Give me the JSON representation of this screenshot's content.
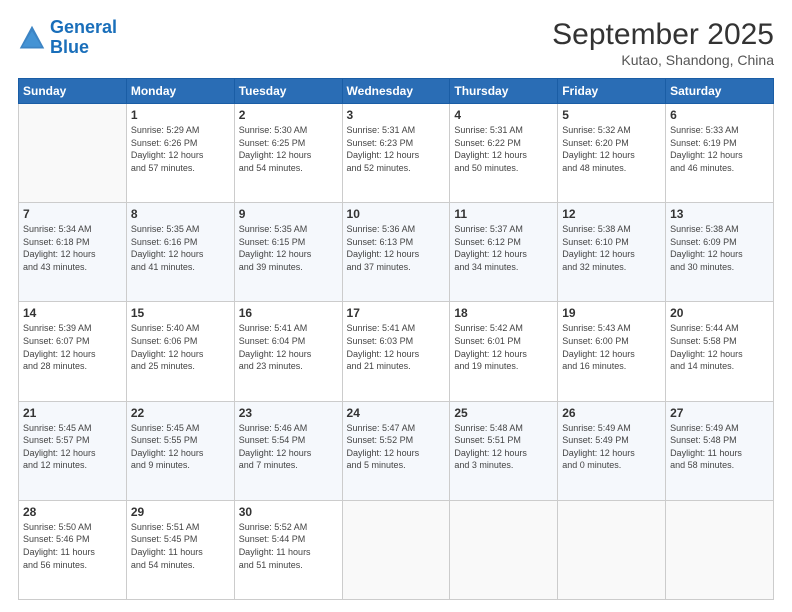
{
  "header": {
    "logo_line1": "General",
    "logo_line2": "Blue",
    "month": "September 2025",
    "location": "Kutao, Shandong, China"
  },
  "weekdays": [
    "Sunday",
    "Monday",
    "Tuesday",
    "Wednesday",
    "Thursday",
    "Friday",
    "Saturday"
  ],
  "weeks": [
    [
      {
        "day": "",
        "content": ""
      },
      {
        "day": "1",
        "content": "Sunrise: 5:29 AM\nSunset: 6:26 PM\nDaylight: 12 hours\nand 57 minutes."
      },
      {
        "day": "2",
        "content": "Sunrise: 5:30 AM\nSunset: 6:25 PM\nDaylight: 12 hours\nand 54 minutes."
      },
      {
        "day": "3",
        "content": "Sunrise: 5:31 AM\nSunset: 6:23 PM\nDaylight: 12 hours\nand 52 minutes."
      },
      {
        "day": "4",
        "content": "Sunrise: 5:31 AM\nSunset: 6:22 PM\nDaylight: 12 hours\nand 50 minutes."
      },
      {
        "day": "5",
        "content": "Sunrise: 5:32 AM\nSunset: 6:20 PM\nDaylight: 12 hours\nand 48 minutes."
      },
      {
        "day": "6",
        "content": "Sunrise: 5:33 AM\nSunset: 6:19 PM\nDaylight: 12 hours\nand 46 minutes."
      }
    ],
    [
      {
        "day": "7",
        "content": "Sunrise: 5:34 AM\nSunset: 6:18 PM\nDaylight: 12 hours\nand 43 minutes."
      },
      {
        "day": "8",
        "content": "Sunrise: 5:35 AM\nSunset: 6:16 PM\nDaylight: 12 hours\nand 41 minutes."
      },
      {
        "day": "9",
        "content": "Sunrise: 5:35 AM\nSunset: 6:15 PM\nDaylight: 12 hours\nand 39 minutes."
      },
      {
        "day": "10",
        "content": "Sunrise: 5:36 AM\nSunset: 6:13 PM\nDaylight: 12 hours\nand 37 minutes."
      },
      {
        "day": "11",
        "content": "Sunrise: 5:37 AM\nSunset: 6:12 PM\nDaylight: 12 hours\nand 34 minutes."
      },
      {
        "day": "12",
        "content": "Sunrise: 5:38 AM\nSunset: 6:10 PM\nDaylight: 12 hours\nand 32 minutes."
      },
      {
        "day": "13",
        "content": "Sunrise: 5:38 AM\nSunset: 6:09 PM\nDaylight: 12 hours\nand 30 minutes."
      }
    ],
    [
      {
        "day": "14",
        "content": "Sunrise: 5:39 AM\nSunset: 6:07 PM\nDaylight: 12 hours\nand 28 minutes."
      },
      {
        "day": "15",
        "content": "Sunrise: 5:40 AM\nSunset: 6:06 PM\nDaylight: 12 hours\nand 25 minutes."
      },
      {
        "day": "16",
        "content": "Sunrise: 5:41 AM\nSunset: 6:04 PM\nDaylight: 12 hours\nand 23 minutes."
      },
      {
        "day": "17",
        "content": "Sunrise: 5:41 AM\nSunset: 6:03 PM\nDaylight: 12 hours\nand 21 minutes."
      },
      {
        "day": "18",
        "content": "Sunrise: 5:42 AM\nSunset: 6:01 PM\nDaylight: 12 hours\nand 19 minutes."
      },
      {
        "day": "19",
        "content": "Sunrise: 5:43 AM\nSunset: 6:00 PM\nDaylight: 12 hours\nand 16 minutes."
      },
      {
        "day": "20",
        "content": "Sunrise: 5:44 AM\nSunset: 5:58 PM\nDaylight: 12 hours\nand 14 minutes."
      }
    ],
    [
      {
        "day": "21",
        "content": "Sunrise: 5:45 AM\nSunset: 5:57 PM\nDaylight: 12 hours\nand 12 minutes."
      },
      {
        "day": "22",
        "content": "Sunrise: 5:45 AM\nSunset: 5:55 PM\nDaylight: 12 hours\nand 9 minutes."
      },
      {
        "day": "23",
        "content": "Sunrise: 5:46 AM\nSunset: 5:54 PM\nDaylight: 12 hours\nand 7 minutes."
      },
      {
        "day": "24",
        "content": "Sunrise: 5:47 AM\nSunset: 5:52 PM\nDaylight: 12 hours\nand 5 minutes."
      },
      {
        "day": "25",
        "content": "Sunrise: 5:48 AM\nSunset: 5:51 PM\nDaylight: 12 hours\nand 3 minutes."
      },
      {
        "day": "26",
        "content": "Sunrise: 5:49 AM\nSunset: 5:49 PM\nDaylight: 12 hours\nand 0 minutes."
      },
      {
        "day": "27",
        "content": "Sunrise: 5:49 AM\nSunset: 5:48 PM\nDaylight: 11 hours\nand 58 minutes."
      }
    ],
    [
      {
        "day": "28",
        "content": "Sunrise: 5:50 AM\nSunset: 5:46 PM\nDaylight: 11 hours\nand 56 minutes."
      },
      {
        "day": "29",
        "content": "Sunrise: 5:51 AM\nSunset: 5:45 PM\nDaylight: 11 hours\nand 54 minutes."
      },
      {
        "day": "30",
        "content": "Sunrise: 5:52 AM\nSunset: 5:44 PM\nDaylight: 11 hours\nand 51 minutes."
      },
      {
        "day": "",
        "content": ""
      },
      {
        "day": "",
        "content": ""
      },
      {
        "day": "",
        "content": ""
      },
      {
        "day": "",
        "content": ""
      }
    ]
  ]
}
